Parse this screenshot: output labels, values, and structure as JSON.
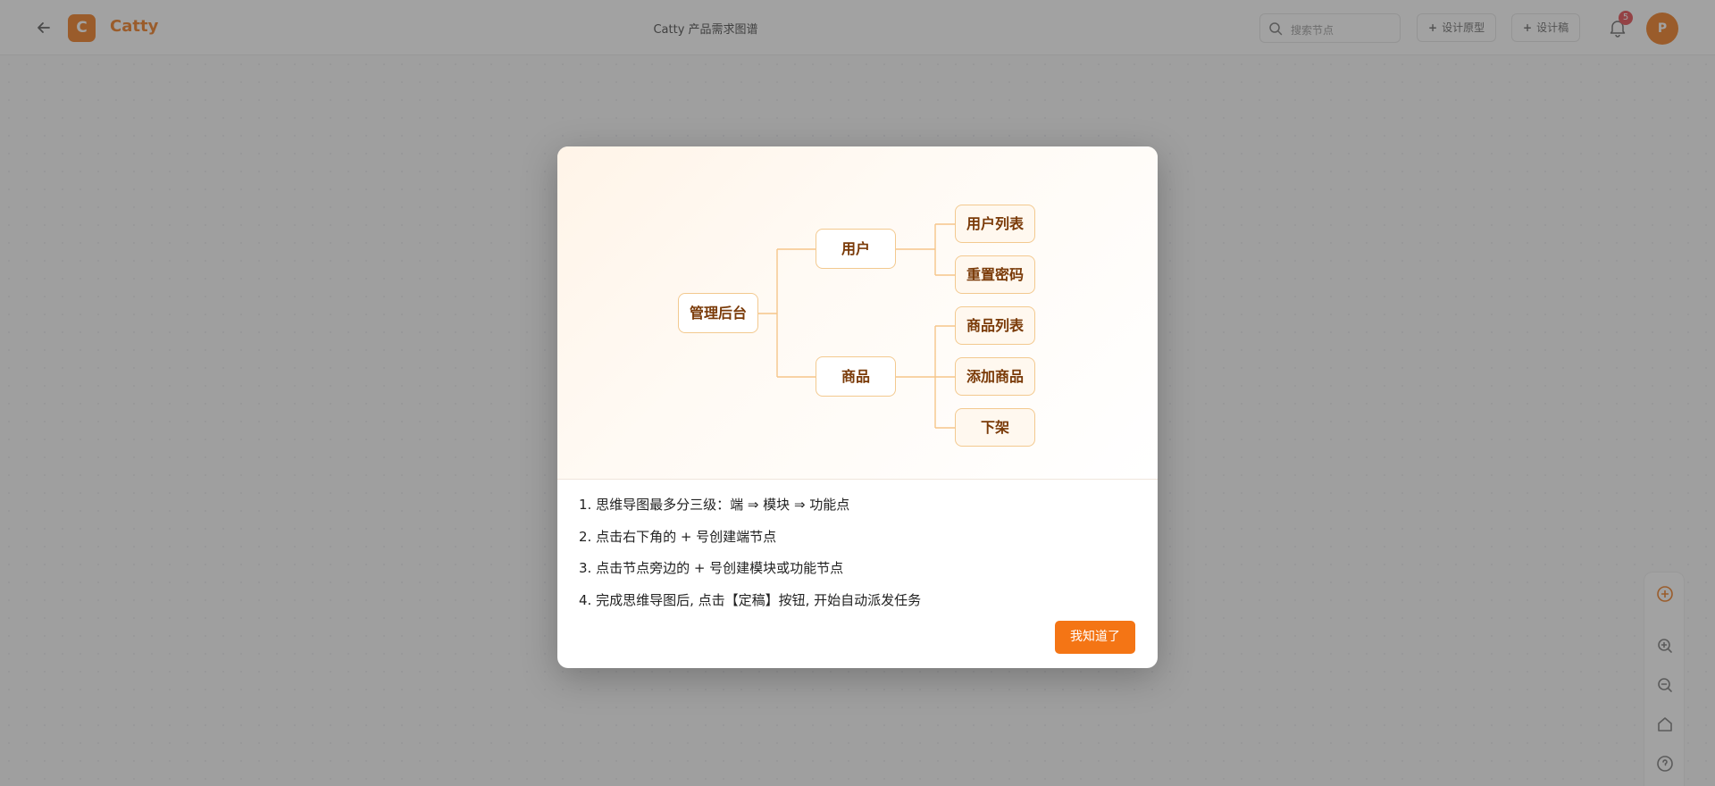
{
  "app": {
    "brand": "Catty",
    "logo_letter": "C",
    "title": "Catty 产品需求图谱"
  },
  "header": {
    "search_placeholder": "搜索节点",
    "design_prototype_label": "设计原型",
    "design_draft_label": "设计稿",
    "plus": "+",
    "notification_count": "5",
    "avatar_letter": "P"
  },
  "modal": {
    "mindmap": {
      "root": "管理后台",
      "modules": [
        {
          "label": "用户",
          "features": [
            "用户列表",
            "重置密码"
          ]
        },
        {
          "label": "商品",
          "features": [
            "商品列表",
            "添加商品",
            "下架"
          ]
        }
      ]
    },
    "steps": [
      "1. 思维导图最多分三级：端 ⇒ 模块 ⇒ 功能点",
      "2. 点击右下角的 + 号创建端节点",
      "3. 点击节点旁边的 + 号创建模块或功能节点",
      "4. 完成思维导图后, 点击【定稿】按钮, 开始自动派发任务"
    ],
    "confirm_label": "我知道了"
  },
  "colors": {
    "accent": "#f07a1b",
    "node_border": "#f3c98f",
    "node_text": "#7a3a08"
  },
  "icons": {
    "back": "arrow-left-icon",
    "search": "search-icon",
    "bell": "bell-icon",
    "locate": "locate-icon",
    "zoom_in": "zoom-in-icon",
    "zoom_out": "zoom-out-icon",
    "home": "home-icon",
    "help": "help-icon"
  }
}
